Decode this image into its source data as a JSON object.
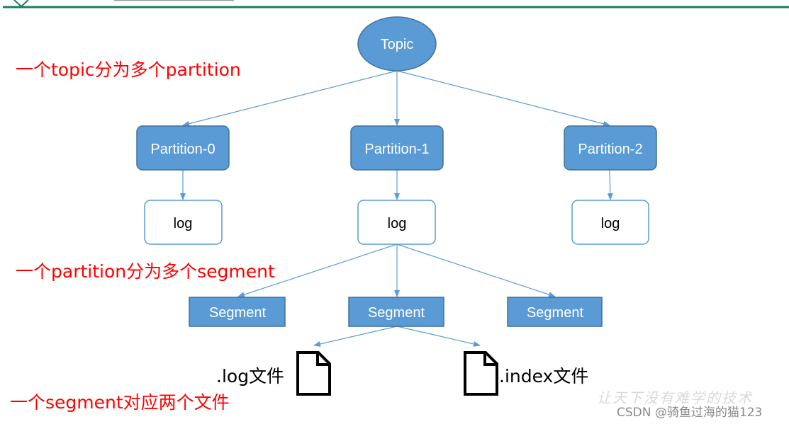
{
  "colors": {
    "node_fill": "#5b9bd5",
    "node_stroke": "#41719c",
    "arrow": "#5b9bd5",
    "annotation": "#ff0000",
    "header_line": "#1a7f5a"
  },
  "diagram": {
    "topic": "Topic",
    "partitions": [
      "Partition-0",
      "Partition-1",
      "Partition-2"
    ],
    "logs": [
      "log",
      "log",
      "log"
    ],
    "segments": [
      "Segment",
      "Segment",
      "Segment"
    ],
    "files": [
      {
        "label": ".log文件",
        "icon": "file-icon"
      },
      {
        "label": ".index文件",
        "icon": "file-icon"
      }
    ]
  },
  "annotations": {
    "topic_note": "一个topic分为多个partition",
    "partition_note": "一个partition分为多个segment",
    "segment_note": "一个segment对应两个文件"
  },
  "watermark": {
    "slogan": "让天下没有难学的技术",
    "credit": "CSDN @骑鱼过海的猫123"
  }
}
